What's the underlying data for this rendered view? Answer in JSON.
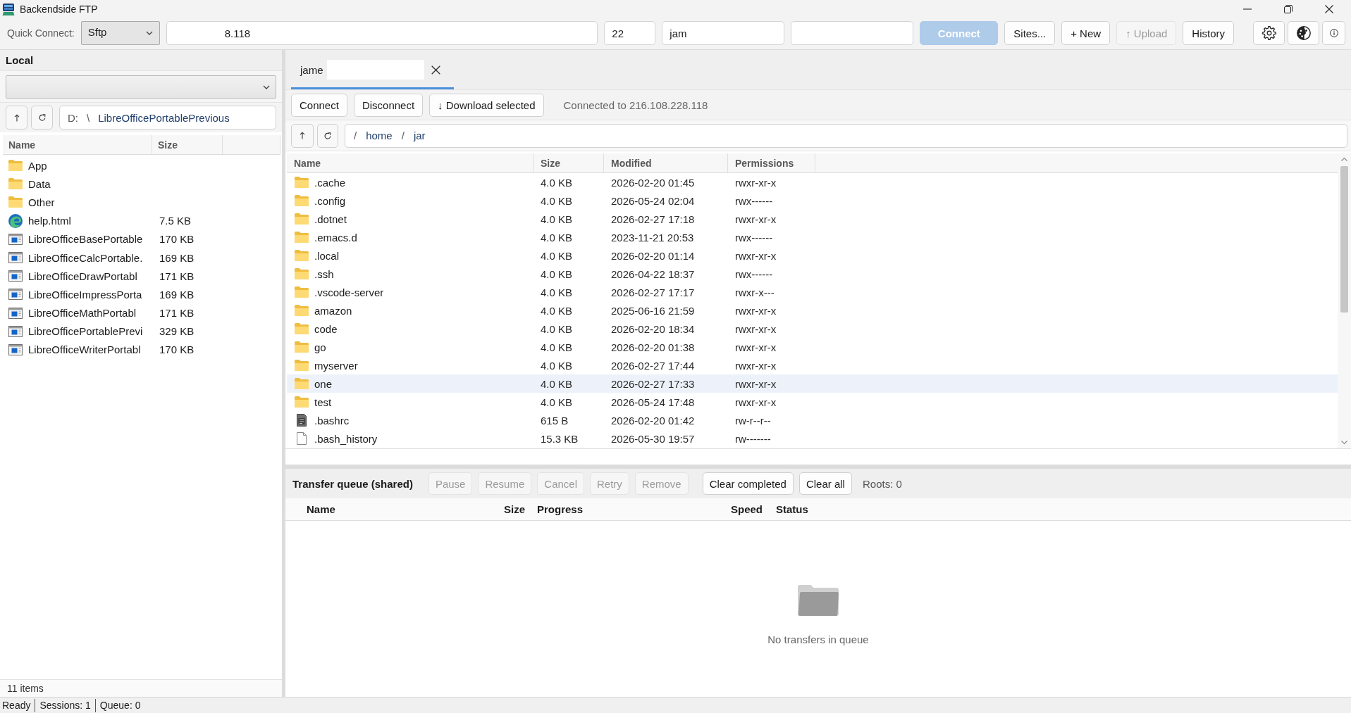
{
  "window": {
    "title": "Backendside FTP"
  },
  "quick_connect": {
    "label": "Quick Connect:",
    "protocol": "Sftp",
    "host": "8.118",
    "port": "22",
    "user": "jam",
    "buttons": [
      {
        "label": "Connect",
        "kind": "primary",
        "disabled": true
      },
      {
        "label": "Sites...",
        "kind": "normal",
        "disabled": false
      },
      {
        "label": "+ New",
        "kind": "normal",
        "disabled": false
      },
      {
        "label": "↑ Upload",
        "kind": "normal",
        "disabled": true
      },
      {
        "label": "History",
        "kind": "normal",
        "disabled": false
      }
    ]
  },
  "local": {
    "title": "Local",
    "path": [
      {
        "text": "D:",
        "kind": "root"
      },
      {
        "text": "\\",
        "kind": "separator"
      },
      {
        "text": "LibreOfficePortablePrevious",
        "kind": "folder"
      }
    ],
    "columns": [
      "Name",
      "Size"
    ],
    "files": [
      {
        "name": "App",
        "kind": "folder"
      },
      {
        "name": "Data",
        "kind": "folder"
      },
      {
        "name": "Other",
        "kind": "folder"
      },
      {
        "name": "help.html",
        "kind": "web",
        "size": "7.5 KB"
      },
      {
        "name": "LibreOfficeBasePortable",
        "kind": "app",
        "size": "170 KB"
      },
      {
        "name": "LibreOfficeCalcPortable.",
        "kind": "app",
        "size": "169 KB"
      },
      {
        "name": "LibreOfficeDrawPortabl",
        "kind": "app",
        "size": "171 KB"
      },
      {
        "name": "LibreOfficeImpressPorta",
        "kind": "app",
        "size": "169 KB"
      },
      {
        "name": "LibreOfficeMathPortabl",
        "kind": "app",
        "size": "171 KB"
      },
      {
        "name": "LibreOfficePortablePrevi",
        "kind": "app",
        "size": "329 KB"
      },
      {
        "name": "LibreOfficeWriterPortabl",
        "kind": "app",
        "size": "170 KB"
      }
    ],
    "footer": "11 items"
  },
  "remote": {
    "tabs": [
      {
        "label": "jame",
        "selected": true
      }
    ],
    "buttons": [
      {
        "label": "Connect",
        "disabled": false
      },
      {
        "label": "Disconnect",
        "disabled": false
      },
      {
        "label": "↓ Download selected",
        "disabled": false
      }
    ],
    "status": "Connected to 216.108.228.118",
    "path": [
      {
        "text": "/",
        "kind": "separator"
      },
      {
        "text": "home",
        "kind": "folder"
      },
      {
        "text": "/",
        "kind": "separator"
      },
      {
        "text": "jar",
        "kind": "folder"
      }
    ],
    "columns": [
      "Name",
      "Size",
      "Modified",
      "Permissions"
    ],
    "files": [
      {
        "name": ".cache",
        "kind": "folder",
        "size": "4.0 KB",
        "modified": "2026-02-20 01:45",
        "permissions": "rwxr-xr-x",
        "selected": false
      },
      {
        "name": ".config",
        "kind": "folder",
        "size": "4.0 KB",
        "modified": "2026-05-24 02:04",
        "permissions": "rwx------",
        "selected": false
      },
      {
        "name": ".dotnet",
        "kind": "folder",
        "size": "4.0 KB",
        "modified": "2026-02-27 17:18",
        "permissions": "rwxr-xr-x",
        "selected": false
      },
      {
        "name": ".emacs.d",
        "kind": "folder",
        "size": "4.0 KB",
        "modified": "2023-11-21 20:53",
        "permissions": "rwx------",
        "selected": false
      },
      {
        "name": ".local",
        "kind": "folder",
        "size": "4.0 KB",
        "modified": "2026-02-20 01:14",
        "permissions": "rwxr-xr-x",
        "selected": false
      },
      {
        "name": ".ssh",
        "kind": "folder",
        "size": "4.0 KB",
        "modified": "2026-04-22 18:37",
        "permissions": "rwx------",
        "selected": false
      },
      {
        "name": ".vscode-server",
        "kind": "folder",
        "size": "4.0 KB",
        "modified": "2026-02-27 17:17",
        "permissions": "rwxr-x---",
        "selected": false
      },
      {
        "name": "amazon",
        "kind": "folder",
        "size": "4.0 KB",
        "modified": "2025-06-16 21:59",
        "permissions": "rwxr-xr-x",
        "selected": false
      },
      {
        "name": "code",
        "kind": "folder",
        "size": "4.0 KB",
        "modified": "2026-02-20 18:34",
        "permissions": "rwxr-xr-x",
        "selected": false
      },
      {
        "name": "go",
        "kind": "folder",
        "size": "4.0 KB",
        "modified": "2026-02-20 01:38",
        "permissions": "rwxr-xr-x",
        "selected": false
      },
      {
        "name": "myserver",
        "kind": "folder",
        "size": "4.0 KB",
        "modified": "2026-02-27 17:44",
        "permissions": "rwxr-xr-x",
        "selected": false
      },
      {
        "name": "one",
        "kind": "folder",
        "size": "4.0 KB",
        "modified": "2026-02-27 17:33",
        "permissions": "rwxr-xr-x",
        "selected": true
      },
      {
        "name": "test",
        "kind": "folder",
        "size": "4.0 KB",
        "modified": "2026-05-24 17:48",
        "permissions": "rwxr-xr-x",
        "selected": false
      },
      {
        "name": ".bashrc",
        "kind": "script",
        "size": "615 B",
        "modified": "2026-02-20 01:42",
        "permissions": "rw-r--r--",
        "selected": false
      },
      {
        "name": ".bash_history",
        "kind": "file",
        "size": "15.3 KB",
        "modified": "2026-05-30 19:57",
        "permissions": "rw-------",
        "selected": false
      }
    ]
  },
  "queue": {
    "title": "Transfer queue (shared)",
    "buttons": [
      {
        "label": "Pause",
        "disabled": true
      },
      {
        "label": "Resume",
        "disabled": true
      },
      {
        "label": "Cancel",
        "disabled": true
      },
      {
        "label": "Retry",
        "disabled": true
      },
      {
        "label": "Remove",
        "disabled": true
      },
      {
        "label": "Clear completed",
        "disabled": false
      },
      {
        "label": "Clear all",
        "disabled": false
      }
    ],
    "roots": "Roots: 0",
    "columns": [
      "Name",
      "Size",
      "Progress",
      "Speed",
      "Status"
    ],
    "empty_message": "No transfers in queue"
  },
  "status_bar": [
    "Ready",
    "Sessions: 1",
    "Queue: 0"
  ]
}
